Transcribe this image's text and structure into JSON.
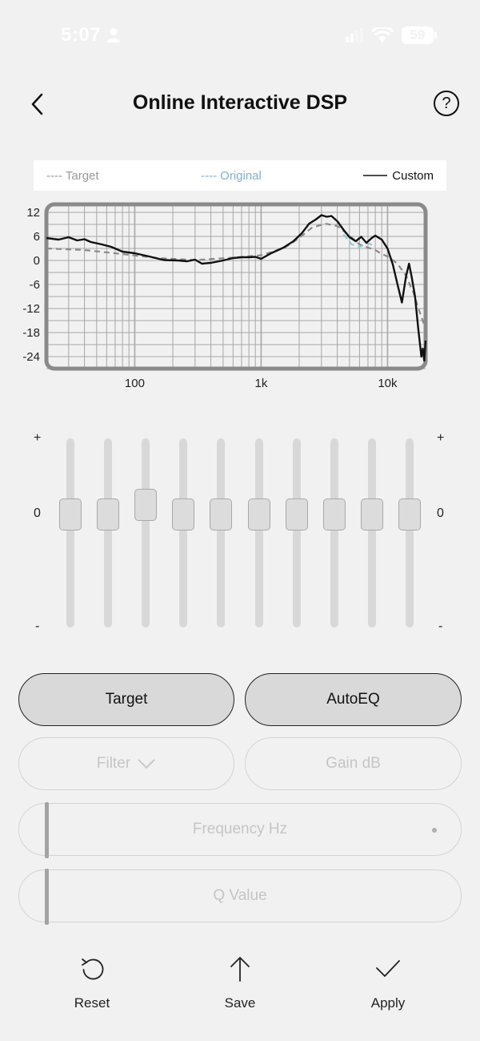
{
  "status_bar": {
    "time": "5:07",
    "battery": "59"
  },
  "header": {
    "title": "Online Interactive DSP",
    "help": "?"
  },
  "legend": {
    "target": "---- Target",
    "original": "---- Original",
    "custom": "Custom"
  },
  "chart_data": {
    "type": "line",
    "x_scale": "log",
    "xlim": [
      20,
      20000
    ],
    "ylim": [
      -27,
      14
    ],
    "yticks": [
      "12",
      "6",
      "0",
      "-6",
      "-12",
      "-18",
      "-24"
    ],
    "xticks": [
      "100",
      "1k",
      "10k"
    ],
    "series": [
      {
        "name": "Target",
        "color": "#8a8a8a",
        "style": "dashed",
        "points": [
          [
            20,
            3
          ],
          [
            40,
            2.6
          ],
          [
            80,
            1.6
          ],
          [
            150,
            0.6
          ],
          [
            300,
            0.1
          ],
          [
            600,
            0.7
          ],
          [
            1000,
            1.3
          ],
          [
            1500,
            3
          ],
          [
            2000,
            5.6
          ],
          [
            2500,
            8.1
          ],
          [
            3200,
            9.2
          ],
          [
            4000,
            8.6
          ],
          [
            5000,
            6.2
          ],
          [
            6000,
            4
          ],
          [
            7000,
            3.2
          ],
          [
            8000,
            2.6
          ],
          [
            9000,
            1.6
          ],
          [
            10000,
            1
          ],
          [
            12000,
            -0.8
          ],
          [
            14000,
            -3.8
          ],
          [
            16000,
            -8
          ],
          [
            18000,
            -13
          ],
          [
            20000,
            -17
          ]
        ]
      },
      {
        "name": "Original",
        "color": "#8ec9d9",
        "style": "dashed",
        "points": [
          [
            4500,
            6.5
          ],
          [
            5200,
            4
          ],
          [
            6000,
            3.4
          ],
          [
            7000,
            4.3
          ],
          [
            8000,
            3.6
          ]
        ]
      },
      {
        "name": "Custom",
        "color": "#111111",
        "style": "solid",
        "points": [
          [
            20,
            5.6
          ],
          [
            25,
            5.2
          ],
          [
            30,
            5.8
          ],
          [
            35,
            5
          ],
          [
            40,
            5.3
          ],
          [
            45,
            4.6
          ],
          [
            55,
            4
          ],
          [
            65,
            3.4
          ],
          [
            80,
            2.2
          ],
          [
            100,
            1.8
          ],
          [
            130,
            1
          ],
          [
            170,
            0.1
          ],
          [
            220,
            0
          ],
          [
            260,
            -0.2
          ],
          [
            300,
            0.2
          ],
          [
            340,
            -0.8
          ],
          [
            400,
            -0.6
          ],
          [
            500,
            0
          ],
          [
            600,
            0.6
          ],
          [
            700,
            0.8
          ],
          [
            800,
            0.8
          ],
          [
            900,
            0.9
          ],
          [
            1000,
            0.4
          ],
          [
            1200,
            1.8
          ],
          [
            1500,
            3.2
          ],
          [
            1800,
            4.8
          ],
          [
            2100,
            6.8
          ],
          [
            2400,
            9.2
          ],
          [
            2700,
            10.2
          ],
          [
            3000,
            11.3
          ],
          [
            3300,
            10.9
          ],
          [
            3600,
            11.1
          ],
          [
            4000,
            9.8
          ],
          [
            4500,
            7.6
          ],
          [
            5000,
            5.8
          ],
          [
            5600,
            4.8
          ],
          [
            6200,
            5.9
          ],
          [
            6800,
            4.4
          ],
          [
            7500,
            5.6
          ],
          [
            8000,
            6.2
          ],
          [
            9000,
            5.2
          ],
          [
            10000,
            3
          ],
          [
            11000,
            -1
          ],
          [
            12000,
            -6
          ],
          [
            13000,
            -10.5
          ],
          [
            14000,
            -4
          ],
          [
            14800,
            -0.8
          ],
          [
            15500,
            -4
          ],
          [
            16500,
            -9
          ],
          [
            17500,
            -17
          ],
          [
            18500,
            -24
          ],
          [
            19000,
            -22
          ],
          [
            19500,
            -25
          ],
          [
            20000,
            -20
          ]
        ]
      }
    ]
  },
  "equalizer": {
    "plus_label": "+",
    "zero_label": "0",
    "minus_label": "-",
    "bands": [
      0,
      0,
      0.5,
      0,
      0,
      0,
      0,
      0,
      0,
      0
    ]
  },
  "buttons": {
    "target": "Target",
    "autoeq": "AutoEQ",
    "filter": "Filter",
    "gain": "Gain  dB",
    "frequency": "Frequency  Hz",
    "q_value": "Q Value"
  },
  "bottom_bar": {
    "reset": "Reset",
    "save": "Save",
    "apply": "Apply"
  },
  "colors": {
    "background": "#f1f1f1",
    "grid": "#a6a6a6",
    "frame": "#8a8a8a"
  }
}
